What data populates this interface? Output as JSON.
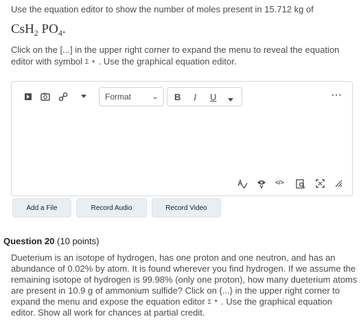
{
  "question19": {
    "intro": "Use the equation editor to show the number of moles present in 15.712 kg of",
    "formula": {
      "p1": "CsH",
      "s1": "2",
      "p2": " PO",
      "s2": "4",
      "p3": "."
    },
    "instr_a": "Click on the [...] in the upper right corner to expand the menu to reveal the equation editor with symbol",
    "sigma": "Σ",
    "instr_b": ". Use the graphical equation editor."
  },
  "editor": {
    "format_label": "Format",
    "bold": "B",
    "italic": "I",
    "underline": "U",
    "more": "⋮",
    "icons": [
      "insert-stuff-icon",
      "image-icon",
      "link-icon",
      "dropdown-icon",
      "spellcheck-icon",
      "accessibility-icon",
      "source-code-icon",
      "preview-icon",
      "fullscreen-icon",
      "resize-icon"
    ]
  },
  "buttons": {
    "add_file": "Add a File",
    "record_audio": "Record Audio",
    "record_video": "Record Video"
  },
  "question20": {
    "title": "Question 20",
    "points": "(10 points)",
    "body_a": "Dueterium is an isotope of hydrogen, has one proton and one neutron, and has an abundance of 0.02% by atom. It is found wherever you find hydrogen.  If we assume the remaining isotope of hydrogen is 99.98% (only one proton), how many dueterium atoms are present in 10.9 g of ammonium sulfide?  Click on {...} in the upper right corner to expand the menu and expose the equation editor",
    "sigma": "Σ",
    "body_b": ".  Use the graphical equation editor.  Show all work for chances at partial credit."
  }
}
